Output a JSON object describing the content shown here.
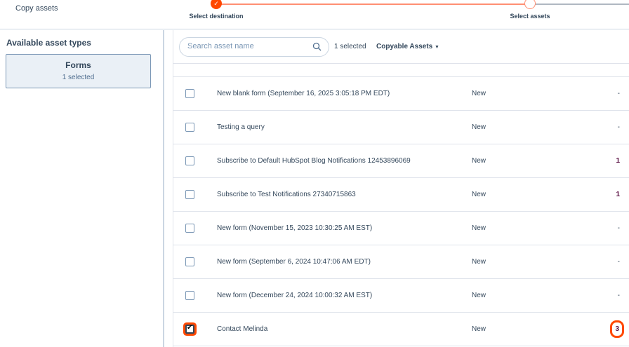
{
  "header": {
    "title": "Copy assets",
    "steps": [
      {
        "label": "Select destination",
        "state": "done"
      },
      {
        "label": "Select assets",
        "state": "current"
      }
    ]
  },
  "sidebar": {
    "heading": "Available asset types",
    "cards": [
      {
        "name": "Forms",
        "selected": "1 selected"
      }
    ]
  },
  "toolbar": {
    "search_placeholder": "Search asset name",
    "search_value": "",
    "selected_count": "1 selected",
    "filter_label": "Copyable Assets"
  },
  "rows": [
    {
      "name": "New blank form (September 16, 2025 3:05:18 PM EDT)",
      "status": "New",
      "count": "-",
      "checked": false
    },
    {
      "name": "Testing a query",
      "status": "New",
      "count": "-",
      "checked": false
    },
    {
      "name": "Subscribe to Default HubSpot Blog Notifications 12453896069",
      "status": "New",
      "count": "1",
      "checked": false
    },
    {
      "name": "Subscribe to Test Notifications 27340715863",
      "status": "New",
      "count": "1",
      "checked": false
    },
    {
      "name": "New form (November 15, 2023 10:30:25 AM EST)",
      "status": "New",
      "count": "-",
      "checked": false
    },
    {
      "name": "New form (September 6, 2024 10:47:06 AM EDT)",
      "status": "New",
      "count": "-",
      "checked": false
    },
    {
      "name": "New form (December 24, 2024 10:00:32 AM EST)",
      "status": "New",
      "count": "-",
      "checked": false
    },
    {
      "name": "Contact Melinda",
      "status": "New",
      "count": "3",
      "checked": true
    }
  ],
  "colors": {
    "accent": "#ff4800",
    "done_line": "#ff8f73"
  }
}
